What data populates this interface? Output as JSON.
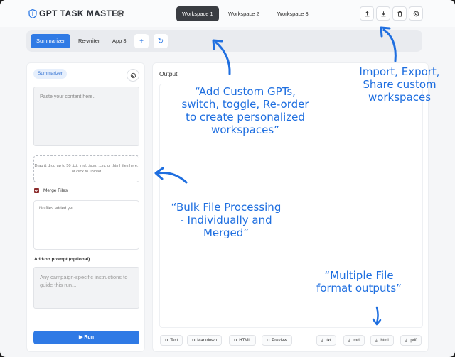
{
  "app": {
    "title": "GPT TASK MASTER"
  },
  "workspaces": [
    {
      "label": "Workspace 1",
      "active": true
    },
    {
      "label": "Workspace 2",
      "active": false
    },
    {
      "label": "Workspace 3",
      "active": false
    }
  ],
  "toolbar_icons": [
    "share-icon",
    "download-icon",
    "trash-icon",
    "settings-icon"
  ],
  "apps": [
    {
      "label": "Summarizer",
      "active": true
    },
    {
      "label": "Re-writer",
      "active": false
    },
    {
      "label": "App 3",
      "active": false
    }
  ],
  "app_actions": {
    "add": "+",
    "refresh": "↻"
  },
  "left": {
    "chip": "Summarizer",
    "content_placeholder": "Paste your content here..",
    "dropzone_text": "Drag & drop up to 50 .txt, .md, .json, .csv, or .html files here, or click to upload",
    "merge_label": "Merge Files",
    "merge_checked": true,
    "file_list_empty": "No files added yet",
    "addon_label": "Add-on prompt (optional)",
    "addon_placeholder": "Any campaign-specific instructions to guide this run...",
    "run_label": "▶ Run"
  },
  "output": {
    "label": "Output",
    "view_buttons": [
      "Text",
      "Markdown",
      "HTML",
      "Preview"
    ],
    "export_buttons": [
      ".txt",
      ".md",
      ".html",
      ".pdf"
    ]
  },
  "annotations": {
    "custom_gpts": [
      "“Add Custom GPTs,",
      "switch, toggle, Re-order",
      "to create personalized",
      "workspaces”"
    ],
    "import_export": [
      "Import, Export,",
      "Share custom",
      "workspaces"
    ],
    "bulk": [
      "“Bulk File Processing",
      "- Individually and",
      "Merged”"
    ],
    "formats": [
      "“Multiple File",
      "format outputs”"
    ]
  },
  "colors": {
    "accent": "#2f7ae5",
    "annotation": "#1f6fe0",
    "dark_tab": "#3a3d42"
  }
}
